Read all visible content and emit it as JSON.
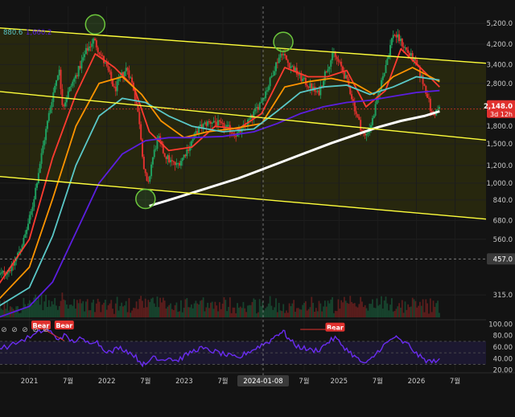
{
  "chart_data": {
    "type": "line",
    "scale": "log",
    "price_axis": {
      "ticks": [
        5200,
        4200,
        3400,
        2800,
        2200,
        1800,
        1500,
        1200,
        1000,
        840,
        680,
        560,
        315
      ],
      "tick_labels": [
        "5,200.0",
        "4,200.0",
        "3,400.0",
        "2,800.0",
        "2,200.0",
        "1,800.0",
        "1,500.0",
        "1,200.0",
        "1,000.0",
        "840.0",
        "680.0",
        "560.0",
        "315.0"
      ],
      "ylim": [
        250,
        6200
      ]
    },
    "last_price": {
      "value": 2148,
      "label": "2,148.0",
      "timer": "3d 12h"
    },
    "crosshair_price": {
      "value": 457,
      "label": "457.0"
    },
    "legend_values": [
      "880.6",
      "1,660.2"
    ],
    "x_axis": {
      "ticks": [
        {
          "t": 2021.0,
          "label": "2021"
        },
        {
          "t": 2021.5,
          "label": "7월"
        },
        {
          "t": 2022.0,
          "label": "2022"
        },
        {
          "t": 2022.5,
          "label": "7월"
        },
        {
          "t": 2023.0,
          "label": "2023"
        },
        {
          "t": 2023.5,
          "label": "7월"
        },
        {
          "t": 2024.0,
          "label": "월"
        },
        {
          "t": 2024.55,
          "label": "7월"
        },
        {
          "t": 2025.0,
          "label": "2025"
        },
        {
          "t": 2025.5,
          "label": "7월"
        },
        {
          "t": 2026.0,
          "label": "2026"
        },
        {
          "t": 2026.5,
          "label": "7월"
        }
      ],
      "crosshair": {
        "t": 2024.02,
        "label": "2024-01-08"
      }
    },
    "price_series": [
      [
        2020.6,
        380
      ],
      [
        2020.8,
        420
      ],
      [
        2020.95,
        560
      ],
      [
        2021.05,
        760
      ],
      [
        2021.2,
        1500
      ],
      [
        2021.3,
        2300
      ],
      [
        2021.4,
        3300
      ],
      [
        2021.45,
        2200
      ],
      [
        2021.55,
        2700
      ],
      [
        2021.65,
        3200
      ],
      [
        2021.75,
        3900
      ],
      [
        2021.85,
        4400
      ],
      [
        2021.95,
        3700
      ],
      [
        2022.05,
        3100
      ],
      [
        2022.12,
        2600
      ],
      [
        2022.2,
        3000
      ],
      [
        2022.28,
        3300
      ],
      [
        2022.36,
        2700
      ],
      [
        2022.44,
        1900
      ],
      [
        2022.5,
        1150
      ],
      [
        2022.55,
        950
      ],
      [
        2022.6,
        1250
      ],
      [
        2022.68,
        1600
      ],
      [
        2022.76,
        1350
      ],
      [
        2022.84,
        1250
      ],
      [
        2022.92,
        1200
      ],
      [
        2023.0,
        1300
      ],
      [
        2023.1,
        1500
      ],
      [
        2023.2,
        1750
      ],
      [
        2023.3,
        1850
      ],
      [
        2023.4,
        1900
      ],
      [
        2023.5,
        1800
      ],
      [
        2023.6,
        1750
      ],
      [
        2023.7,
        1650
      ],
      [
        2023.8,
        1800
      ],
      [
        2023.9,
        2000
      ],
      [
        2024.0,
        2300
      ],
      [
        2024.1,
        2700
      ],
      [
        2024.2,
        3400
      ],
      [
        2024.28,
        3900
      ],
      [
        2024.35,
        3500
      ],
      [
        2024.45,
        3200
      ],
      [
        2024.55,
        2900
      ],
      [
        2024.65,
        2700
      ],
      [
        2024.75,
        2500
      ],
      [
        2024.85,
        3200
      ],
      [
        2024.95,
        3800
      ],
      [
        2025.05,
        3300
      ],
      [
        2025.15,
        2700
      ],
      [
        2025.25,
        2000
      ],
      [
        2025.35,
        1600
      ],
      [
        2025.45,
        1900
      ],
      [
        2025.55,
        2700
      ],
      [
        2025.65,
        3700
      ],
      [
        2025.72,
        4700
      ],
      [
        2025.8,
        4400
      ],
      [
        2025.9,
        3900
      ],
      [
        2026.0,
        3500
      ],
      [
        2026.08,
        3000
      ],
      [
        2026.16,
        2500
      ],
      [
        2026.22,
        2000
      ],
      [
        2026.3,
        2148
      ]
    ],
    "moving_averages": [
      {
        "color": "#ff3b30",
        "points": [
          [
            2020.6,
            350
          ],
          [
            2021.0,
            560
          ],
          [
            2021.3,
            1300
          ],
          [
            2021.6,
            2500
          ],
          [
            2021.85,
            3800
          ],
          [
            2022.1,
            3300
          ],
          [
            2022.35,
            2700
          ],
          [
            2022.55,
            1700
          ],
          [
            2022.8,
            1400
          ],
          [
            2023.1,
            1450
          ],
          [
            2023.4,
            1800
          ],
          [
            2023.7,
            1750
          ],
          [
            2024.0,
            2050
          ],
          [
            2024.3,
            3300
          ],
          [
            2024.6,
            3000
          ],
          [
            2024.85,
            3000
          ],
          [
            2025.1,
            3200
          ],
          [
            2025.35,
            2200
          ],
          [
            2025.6,
            2600
          ],
          [
            2025.8,
            4000
          ],
          [
            2026.05,
            3300
          ],
          [
            2026.3,
            2700
          ]
        ]
      },
      {
        "color": "#ff9500",
        "points": [
          [
            2020.6,
            300
          ],
          [
            2021.0,
            420
          ],
          [
            2021.3,
            850
          ],
          [
            2021.6,
            1800
          ],
          [
            2021.9,
            2800
          ],
          [
            2022.2,
            3000
          ],
          [
            2022.45,
            2500
          ],
          [
            2022.7,
            1900
          ],
          [
            2023.0,
            1600
          ],
          [
            2023.3,
            1700
          ],
          [
            2023.6,
            1750
          ],
          [
            2024.0,
            1850
          ],
          [
            2024.3,
            2700
          ],
          [
            2024.6,
            2850
          ],
          [
            2024.9,
            2950
          ],
          [
            2025.2,
            2800
          ],
          [
            2025.45,
            2500
          ],
          [
            2025.7,
            3000
          ],
          [
            2025.95,
            3300
          ],
          [
            2026.3,
            2850
          ]
        ]
      },
      {
        "color": "#5ac8c8",
        "points": [
          [
            2020.6,
            280
          ],
          [
            2021.0,
            340
          ],
          [
            2021.3,
            580
          ],
          [
            2021.6,
            1200
          ],
          [
            2021.9,
            2000
          ],
          [
            2022.2,
            2400
          ],
          [
            2022.5,
            2300
          ],
          [
            2022.8,
            2000
          ],
          [
            2023.1,
            1800
          ],
          [
            2023.5,
            1700
          ],
          [
            2023.9,
            1750
          ],
          [
            2024.2,
            2100
          ],
          [
            2024.5,
            2550
          ],
          [
            2024.8,
            2700
          ],
          [
            2025.1,
            2750
          ],
          [
            2025.4,
            2500
          ],
          [
            2025.7,
            2700
          ],
          [
            2026.0,
            3000
          ],
          [
            2026.3,
            2900
          ]
        ]
      },
      {
        "color": "#5b1ee0",
        "points": [
          [
            2020.6,
            250
          ],
          [
            2021.0,
            280
          ],
          [
            2021.3,
            360
          ],
          [
            2021.6,
            600
          ],
          [
            2021.9,
            1000
          ],
          [
            2022.2,
            1350
          ],
          [
            2022.5,
            1550
          ],
          [
            2022.8,
            1600
          ],
          [
            2023.1,
            1600
          ],
          [
            2023.5,
            1620
          ],
          [
            2023.9,
            1700
          ],
          [
            2024.2,
            1850
          ],
          [
            2024.5,
            2050
          ],
          [
            2024.8,
            2200
          ],
          [
            2025.1,
            2300
          ],
          [
            2025.4,
            2350
          ],
          [
            2025.7,
            2450
          ],
          [
            2026.0,
            2550
          ],
          [
            2026.3,
            2600
          ]
        ]
      },
      {
        "color": "#ffffff",
        "points": [
          [
            2022.55,
            790
          ],
          [
            2022.9,
            860
          ],
          [
            2023.3,
            950
          ],
          [
            2023.7,
            1050
          ],
          [
            2024.0,
            1150
          ],
          [
            2024.3,
            1260
          ],
          [
            2024.6,
            1380
          ],
          [
            2024.9,
            1510
          ],
          [
            2025.2,
            1640
          ],
          [
            2025.5,
            1780
          ],
          [
            2025.8,
            1900
          ],
          [
            2026.1,
            2000
          ],
          [
            2026.3,
            2100
          ]
        ]
      }
    ],
    "channel_lines": [
      {
        "name": "upper",
        "color": "#ffff3b",
        "from": [
          2020.5,
          5000
        ],
        "to": [
          2026.9,
          3450
        ]
      },
      {
        "name": "middle",
        "color": "#ffff3b",
        "from": [
          2020.5,
          2600
        ],
        "to": [
          2026.9,
          1560
        ]
      },
      {
        "name": "lower",
        "color": "#ffff3b",
        "from": [
          2020.5,
          1080
        ],
        "to": [
          2026.9,
          690
        ]
      }
    ],
    "pivot_markers": [
      [
        2021.85,
        5150
      ],
      [
        2022.5,
        850
      ],
      [
        2024.28,
        4300
      ]
    ],
    "rsi": {
      "ylim": [
        18,
        102
      ],
      "ticks": [
        100,
        80,
        60,
        40,
        20
      ],
      "tick_labels": [
        "100.00",
        "80.00",
        "60.00",
        "40.00",
        "20.00"
      ],
      "mid_line": 50,
      "band": [
        30,
        70
      ],
      "values": [
        [
          2020.6,
          58
        ],
        [
          2020.75,
          62
        ],
        [
          2020.9,
          72
        ],
        [
          2021.05,
          80
        ],
        [
          2021.15,
          88
        ],
        [
          2021.25,
          90
        ],
        [
          2021.35,
          74
        ],
        [
          2021.45,
          80
        ],
        [
          2021.55,
          70
        ],
        [
          2021.65,
          74
        ],
        [
          2021.75,
          68
        ],
        [
          2021.85,
          72
        ],
        [
          2021.95,
          58
        ],
        [
          2022.05,
          50
        ],
        [
          2022.15,
          60
        ],
        [
          2022.25,
          54
        ],
        [
          2022.35,
          46
        ],
        [
          2022.45,
          32
        ],
        [
          2022.5,
          28
        ],
        [
          2022.6,
          45
        ],
        [
          2022.7,
          38
        ],
        [
          2022.8,
          42
        ],
        [
          2022.9,
          36
        ],
        [
          2023.0,
          44
        ],
        [
          2023.1,
          52
        ],
        [
          2023.2,
          58
        ],
        [
          2023.3,
          55
        ],
        [
          2023.4,
          52
        ],
        [
          2023.5,
          48
        ],
        [
          2023.6,
          44
        ],
        [
          2023.7,
          40
        ],
        [
          2023.8,
          50
        ],
        [
          2023.9,
          56
        ],
        [
          2024.0,
          64
        ],
        [
          2024.1,
          70
        ],
        [
          2024.2,
          82
        ],
        [
          2024.28,
          88
        ],
        [
          2024.35,
          74
        ],
        [
          2024.45,
          62
        ],
        [
          2024.55,
          58
        ],
        [
          2024.65,
          54
        ],
        [
          2024.75,
          56
        ],
        [
          2024.85,
          68
        ],
        [
          2024.95,
          76
        ],
        [
          2025.05,
          62
        ],
        [
          2025.15,
          50
        ],
        [
          2025.25,
          38
        ],
        [
          2025.35,
          30
        ],
        [
          2025.45,
          44
        ],
        [
          2025.55,
          60
        ],
        [
          2025.65,
          70
        ],
        [
          2025.72,
          78
        ],
        [
          2025.8,
          70
        ],
        [
          2025.9,
          64
        ],
        [
          2026.0,
          48
        ],
        [
          2026.1,
          38
        ],
        [
          2026.2,
          34
        ],
        [
          2026.3,
          40
        ]
      ]
    },
    "bear_labels": [
      {
        "text": "Bear",
        "t": 2021.15
      },
      {
        "text": "Bear",
        "t": 2021.45
      },
      {
        "text": "Bear",
        "t": 2024.95
      }
    ],
    "indicator_icons": [
      "⊘",
      "⊘",
      "⊘",
      "⊘",
      "⊘"
    ],
    "colors": {
      "background": "#131313",
      "channel_fill": "#2b2b0e",
      "candle_up": "#1f9f5f",
      "candle_down": "#e0312e",
      "rsi_line": "#6a2cf0",
      "rsi_band": "#1c1830",
      "price_badge": "#e0312e",
      "axis_text": "#c8c8c8"
    }
  }
}
